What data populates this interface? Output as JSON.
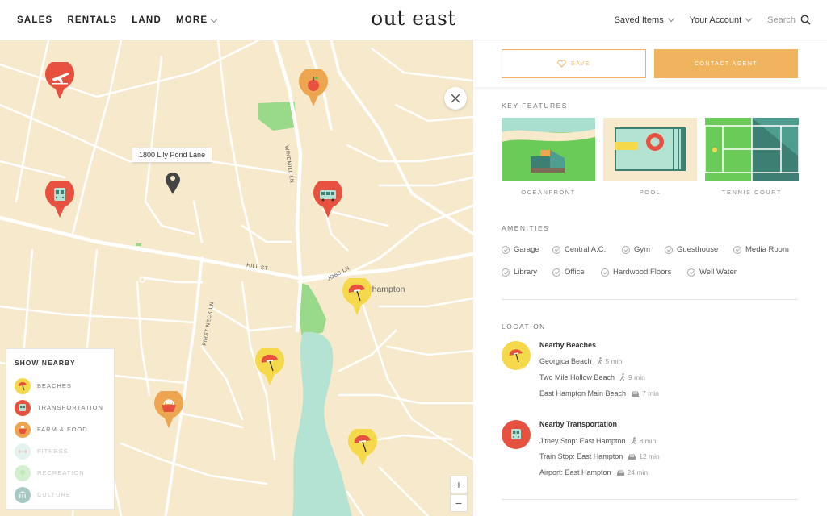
{
  "header": {
    "nav": [
      "SALES",
      "RENTALS",
      "LAND",
      "MORE"
    ],
    "logo": "out east",
    "saved_items": "Saved Items",
    "account": "Your Account",
    "search": "Search"
  },
  "map": {
    "address": "1800 Lily Pond Lane",
    "town": "Southampton",
    "streets": [
      "WINDMILL LN",
      "HILL ST",
      "JOBS LN",
      "FIRST NECK LN"
    ],
    "zoom_in": "+",
    "zoom_out": "−"
  },
  "nearby": {
    "title": "SHOW NEARBY",
    "items": [
      "BEACHES",
      "TRANSPORTATION",
      "FARM & FOOD",
      "FITNESS",
      "RECREATION",
      "CULTURE"
    ]
  },
  "actions": {
    "save": "SAVE",
    "contact": "CONTACT AGENT"
  },
  "key_features": {
    "title": "KEY FEATURES",
    "items": [
      "OCEANFRONT",
      "POOL",
      "TENNIS COURT"
    ]
  },
  "amenities": {
    "title": "AMENITIES",
    "items": [
      "Garage",
      "Central A.C.",
      "Gym",
      "Guesthouse",
      "Media Room",
      "Library",
      "Office",
      "Hardwood Floors",
      "Well Water"
    ]
  },
  "location": {
    "title": "LOCATION",
    "beaches": {
      "heading": "Nearby Beaches",
      "rows": [
        {
          "name": "Georgica Beach",
          "time": "5 min",
          "mode": "walk"
        },
        {
          "name": "Two Mile Hollow Beach",
          "time": "9 min",
          "mode": "walk"
        },
        {
          "name": "East Hampton Main Beach",
          "time": "7 min",
          "mode": "car"
        }
      ]
    },
    "transportation": {
      "heading": "Nearby Transportation",
      "rows": [
        {
          "name": "Jitney Stop: East Hampton",
          "time": "8 min",
          "mode": "walk"
        },
        {
          "name": "Train Stop: East Hampton",
          "time": "12 min",
          "mode": "car"
        },
        {
          "name": "Airport: East Hampton",
          "time": "24 min",
          "mode": "car"
        }
      ]
    }
  },
  "colors": {
    "accent": "#f0b35e",
    "map_bg": "#f7e9cb",
    "beach": "#f5d94a",
    "transport": "#e8513f",
    "food": "#eea54f",
    "water": "#b5e3d3",
    "park": "#98d98a"
  }
}
